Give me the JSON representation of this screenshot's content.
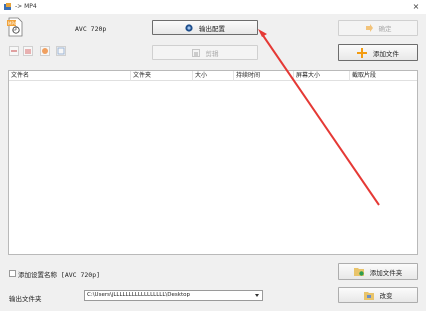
{
  "window": {
    "title": "-> MP4",
    "close_glyph": "×"
  },
  "preset": {
    "label": "AVC 720p",
    "icon": "mp4-file-icon"
  },
  "buttons": {
    "output_settings": "输出配置",
    "ok": "确定",
    "add_file": "添加文件",
    "clip": "剪辑",
    "add_folder": "添加文件夹",
    "change": "改变"
  },
  "file_table": {
    "columns": [
      "文件名",
      "文件夹",
      "大小",
      "持续时间",
      "屏幕大小",
      "截取片段"
    ],
    "rows": []
  },
  "options": {
    "append_preset_name": "添加设置名称 [AVC 720p]",
    "append_preset_checked": false
  },
  "output": {
    "label": "输出文件夹",
    "path": "C:\\Users\\jLLLLLLLLLLLLLLLLL\\Desktop"
  },
  "colors": {
    "annotation_arrow": "#e53935",
    "add_icon": "#f39c12"
  }
}
